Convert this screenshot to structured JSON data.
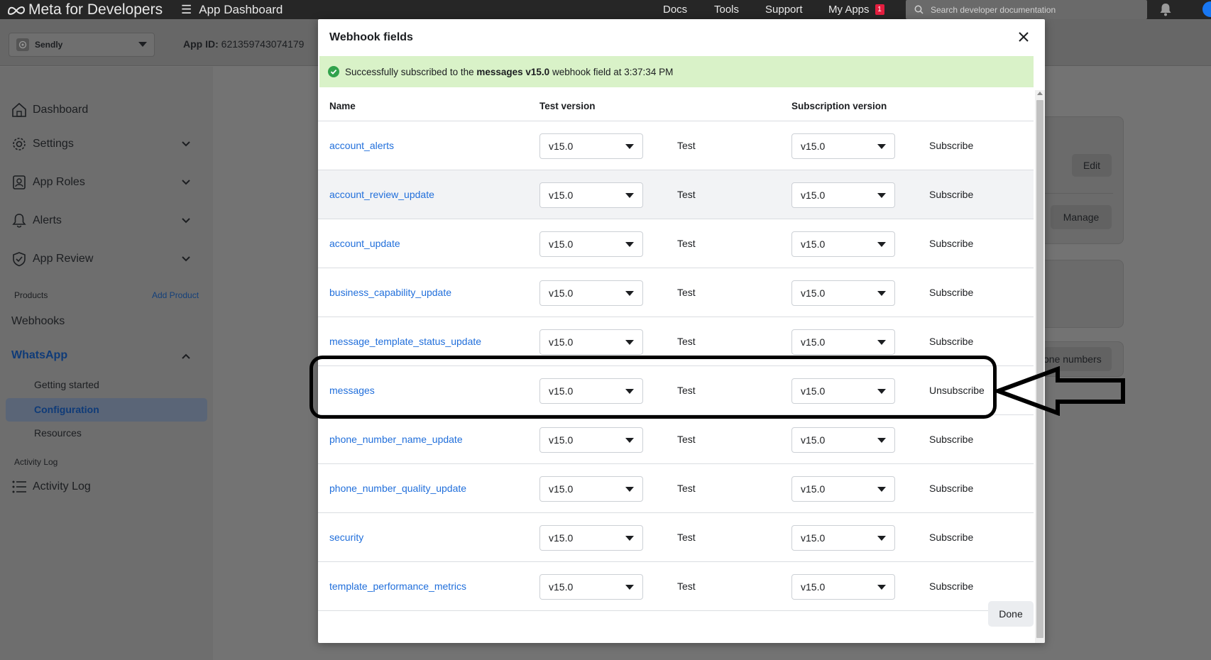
{
  "topbar": {
    "brand": "Meta for Developers",
    "app_dashboard": "App Dashboard",
    "nav": [
      "Docs",
      "Tools",
      "Support",
      "My Apps"
    ],
    "my_apps_badge": "1",
    "search_placeholder": "Search developer documentation"
  },
  "app_header": {
    "app_name": "Sendly",
    "app_id_label": "App ID:",
    "app_id_value": "621359743074179"
  },
  "sidebar": {
    "items": [
      {
        "label": "Dashboard",
        "icon": "home-icon"
      },
      {
        "label": "Settings",
        "icon": "gear-icon"
      },
      {
        "label": "App Roles",
        "icon": "id-badge-icon"
      },
      {
        "label": "Alerts",
        "icon": "bell-icon"
      },
      {
        "label": "App Review",
        "icon": "shield-check-icon"
      }
    ],
    "products_label": "Products",
    "add_product": "Add Product",
    "webhooks": "Webhooks",
    "whatsapp": "WhatsApp",
    "whatsapp_sub": [
      "Getting started",
      "Configuration",
      "Resources"
    ],
    "activity_log_group": "Activity Log",
    "activity_log_item": "Activity Log"
  },
  "background": {
    "edit_button": "Edit",
    "manage_button": "Manage",
    "phone_numbers_fragment": "one numbers"
  },
  "modal": {
    "title": "Webhook fields",
    "success": {
      "prefix": "Successfully subscribed to the",
      "field": "messages v15.0",
      "suffix": "webhook field at 3:37:34 PM"
    },
    "columns": {
      "name": "Name",
      "test_version": "Test version",
      "subscription_version": "Subscription version"
    },
    "rows": [
      {
        "name": "account_alerts",
        "test_version": "v15.0",
        "test": "Test",
        "sub_version": "v15.0",
        "action": "Subscribe"
      },
      {
        "name": "account_review_update",
        "test_version": "v15.0",
        "test": "Test",
        "sub_version": "v15.0",
        "action": "Subscribe"
      },
      {
        "name": "account_update",
        "test_version": "v15.0",
        "test": "Test",
        "sub_version": "v15.0",
        "action": "Subscribe"
      },
      {
        "name": "business_capability_update",
        "test_version": "v15.0",
        "test": "Test",
        "sub_version": "v15.0",
        "action": "Subscribe"
      },
      {
        "name": "message_template_status_update",
        "test_version": "v15.0",
        "test": "Test",
        "sub_version": "v15.0",
        "action": "Subscribe"
      },
      {
        "name": "messages",
        "test_version": "v15.0",
        "test": "Test",
        "sub_version": "v15.0",
        "action": "Unsubscribe"
      },
      {
        "name": "phone_number_name_update",
        "test_version": "v15.0",
        "test": "Test",
        "sub_version": "v15.0",
        "action": "Subscribe"
      },
      {
        "name": "phone_number_quality_update",
        "test_version": "v15.0",
        "test": "Test",
        "sub_version": "v15.0",
        "action": "Subscribe"
      },
      {
        "name": "security",
        "test_version": "v15.0",
        "test": "Test",
        "sub_version": "v15.0",
        "action": "Subscribe"
      },
      {
        "name": "template_performance_metrics",
        "test_version": "v15.0",
        "test": "Test",
        "sub_version": "v15.0",
        "action": "Subscribe"
      }
    ],
    "done_button": "Done"
  },
  "colors": {
    "link": "#216fdb",
    "success_bg": "#d9f2c8",
    "success_icon": "#31a24c",
    "badge": "#e41e3f"
  }
}
